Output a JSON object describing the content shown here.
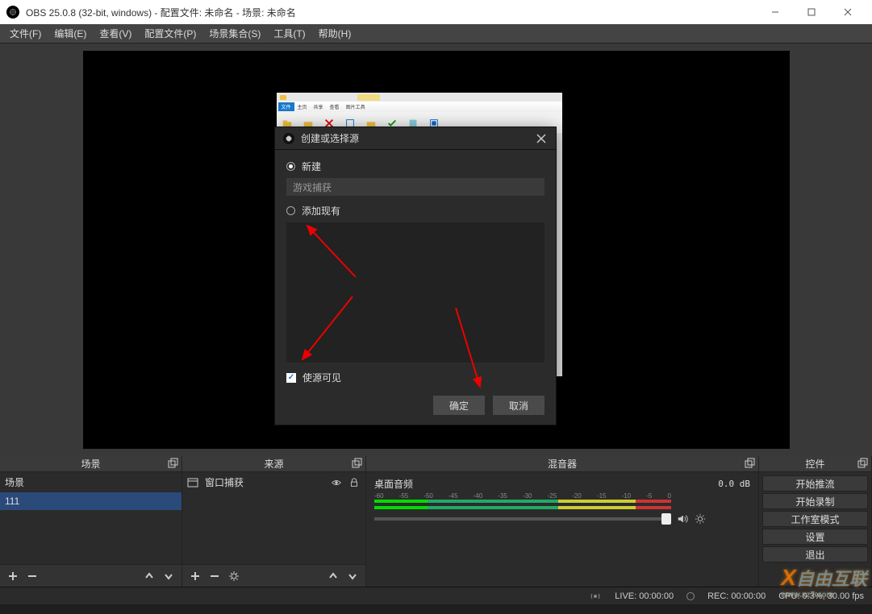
{
  "titlebar": {
    "title": "OBS 25.0.8 (32-bit, windows) - 配置文件: 未命名 - 场景: 未命名"
  },
  "menu": {
    "file": "文件(F)",
    "edit": "编辑(E)",
    "view": "查看(V)",
    "profile": "配置文件(P)",
    "scene_collection": "场景集合(S)",
    "tools": "工具(T)",
    "help": "帮助(H)"
  },
  "captured_ribbon": {
    "tab1": "文件",
    "tab2": "主页",
    "tab3": "共享",
    "tab4": "查看",
    "tab5": "图片工具"
  },
  "dialog": {
    "title": "创建或选择源",
    "radio_new": "新建",
    "input_value": "游戏捕获",
    "radio_existing": "添加现有",
    "checkbox_visible": "使源可见",
    "ok": "确定",
    "cancel": "取消"
  },
  "panels": {
    "scenes_title": "场景",
    "sources_title": "来源",
    "mixer_title": "混音器",
    "controls_title": "控件"
  },
  "scenes": {
    "items": [
      "场景",
      "111"
    ]
  },
  "sources": {
    "items": [
      "窗口捕获"
    ]
  },
  "mixer": {
    "track_name": "桌面音频",
    "db": "0.0 dB",
    "ticks": [
      "-60",
      "-55",
      "-50",
      "-45",
      "-40",
      "-35",
      "-30",
      "-25",
      "-20",
      "-15",
      "-10",
      "-5",
      "0"
    ]
  },
  "controls": {
    "start_stream": "开始推流",
    "start_record": "开始录制",
    "studio_mode": "工作室模式",
    "settings": "设置",
    "exit": "退出"
  },
  "status": {
    "live": "LIVE: 00:00:00",
    "rec": "REC: 00:00:00",
    "cpu_fps": "CPU: 0.3%, 30.00 fps"
  },
  "watermark": {
    "brand": "自由互联",
    "url": "www.xz7.com"
  }
}
